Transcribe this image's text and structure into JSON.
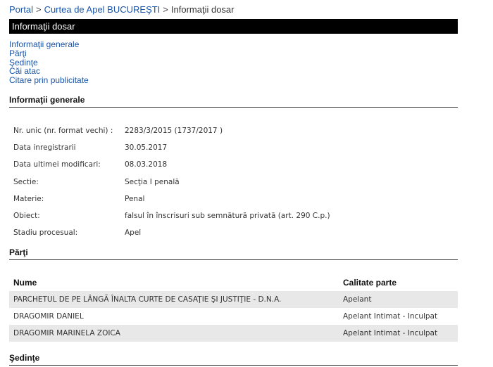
{
  "breadcrumb": {
    "items": [
      "Portal",
      "Curtea de Apel BUCUREŞTI"
    ],
    "current": "Informaţii dosar",
    "separator": ">"
  },
  "title_bar": "Informaţii dosar",
  "nav": {
    "links": [
      "Informaţii generale",
      "Părţi",
      "Şedinţe",
      "Căi atac",
      "Citare prin publicitate"
    ]
  },
  "general": {
    "heading": "Informaţii generale",
    "rows": [
      {
        "label": "Nr. unic (nr. format vechi) :",
        "value": "2283/3/2015 (1737/2017 )"
      },
      {
        "label": "Data inregistrarii",
        "value": "30.05.2017"
      },
      {
        "label": "Data ultimei modificari:",
        "value": "08.03.2018"
      },
      {
        "label": "Sectie:",
        "value": "Secţia I penală"
      },
      {
        "label": "Materie:",
        "value": "Penal"
      },
      {
        "label": "Obiect:",
        "value": "falsul în înscrisuri sub semnătură privată (art. 290 C.p.)"
      },
      {
        "label": "Stadiu procesual:",
        "value": "Apel"
      }
    ]
  },
  "parti": {
    "heading": "Părţi",
    "columns": [
      "Nume",
      "Calitate parte"
    ],
    "rows": [
      {
        "name": "PARCHETUL DE PE LÂNGĂ ÎNALTA CURTE DE CASAŢIE ŞI JUSTIŢIE - D.N.A.",
        "role": "Apelant"
      },
      {
        "name": "DRAGOMIR DANIEL",
        "role": "Apelant Intimat - Inculpat"
      },
      {
        "name": "DRAGOMIR MARINELA ZOICA",
        "role": "Apelant Intimat - Inculpat"
      }
    ]
  },
  "sedinte": {
    "heading": "Şedinţe"
  },
  "colors": {
    "link": "#1a55a8",
    "titlebar_bg": "#000000",
    "row_shade": "#e8e8e8"
  }
}
